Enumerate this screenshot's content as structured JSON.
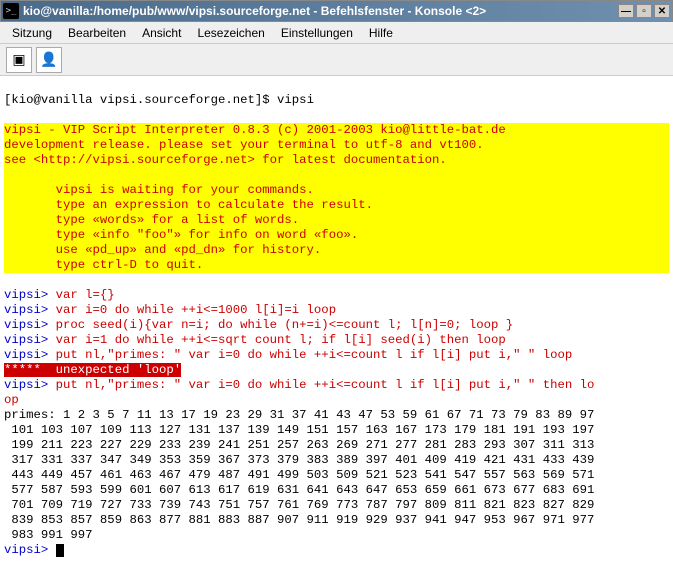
{
  "window": {
    "title": "kio@vanilla:/home/pub/www/vipsi.sourceforge.net - Befehlsfenster - Konsole <2>"
  },
  "menu": {
    "items": [
      "Sitzung",
      "Bearbeiten",
      "Ansicht",
      "Lesezeichen",
      "Einstellungen",
      "Hilfe"
    ]
  },
  "shell": {
    "prompt": "[kio@vanilla vipsi.sourceforge.net]$ ",
    "cmd": "vipsi"
  },
  "banner": {
    "l1": "vipsi - VIP Script Interpreter 0.8.3 (c) 2001-2003 kio@little-bat.de",
    "l2": "development release. please set your terminal to utf-8 and vt100.",
    "l3": "see <http://vipsi.sourceforge.net> for latest documentation.",
    "l4": "       vipsi is waiting for your commands.",
    "l5": "       type an expression to calculate the result.",
    "l6": "       type «words» for a list of words.",
    "l7": "       type «info \"foo\"» for info on word «foo».",
    "l8": "       use «pd_up» and «pd_dn» for history.",
    "l9": "       type ctrl-D to quit."
  },
  "lines": {
    "p": "vipsi> ",
    "c1": "var l={}",
    "c2": "var i=0 do while ++i<=1000 l[i]=i loop",
    "c3": "proc seed(i){var n=i; do while (n+=i)<=count l; l[n]=0; loop }",
    "c4": "var i=1 do while ++i<=sqrt count l; if l[i] seed(i) then loop",
    "c5": "put nl,\"primes: \" var i=0 do while ++i<=count l if l[i] put i,\" \" loop",
    "err": "*****  unexpected 'loop'",
    "c6a": "put nl,\"primes: \" var i=0 do while ++i<=count l if l[i] put i,\" \" then lo",
    "c6b": "op",
    "out1": "primes: 1 2 3 5 7 11 13 17 19 23 29 31 37 41 43 47 53 59 61 67 71 73 79 83 89 97",
    "out2": " 101 103 107 109 113 127 131 137 139 149 151 157 163 167 173 179 181 191 193 197",
    "out3": " 199 211 223 227 229 233 239 241 251 257 263 269 271 277 281 283 293 307 311 313",
    "out4": " 317 331 337 347 349 353 359 367 373 379 383 389 397 401 409 419 421 431 433 439",
    "out5": " 443 449 457 461 463 467 479 487 491 499 503 509 521 523 541 547 557 563 569 571",
    "out6": " 577 587 593 599 601 607 613 617 619 631 641 643 647 653 659 661 673 677 683 691",
    "out7": " 701 709 719 727 733 739 743 751 757 761 769 773 787 797 809 811 821 823 827 829",
    "out8": " 839 853 857 859 863 877 881 883 887 907 911 919 929 937 941 947 953 967 971 977",
    "out9": " 983 991 997"
  }
}
